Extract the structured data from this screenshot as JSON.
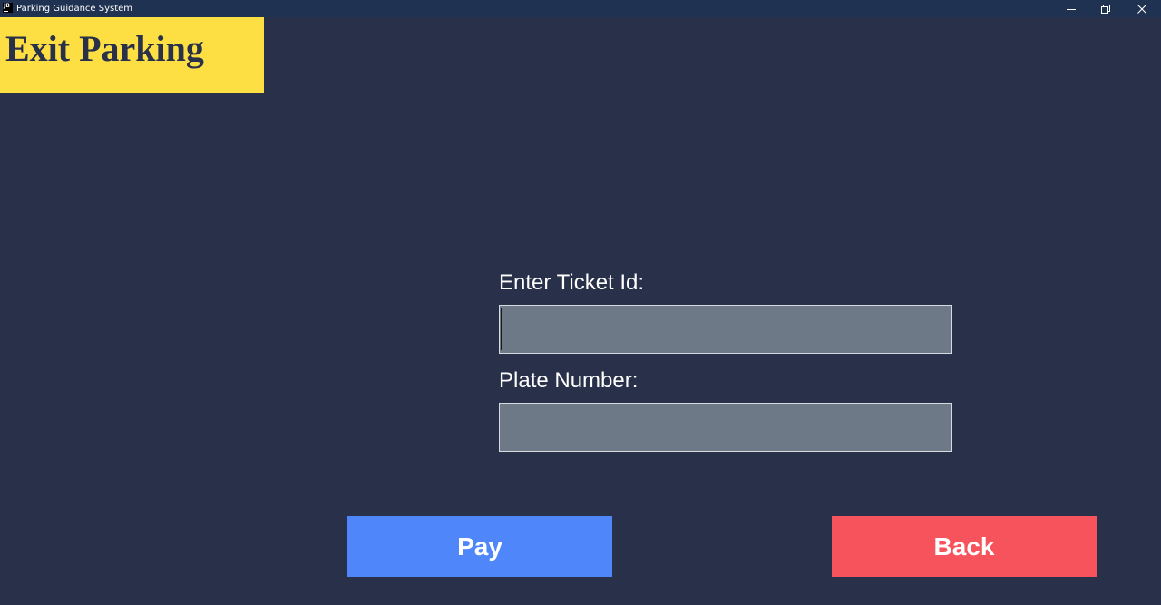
{
  "window": {
    "title": "Parking Guidance System",
    "icon_text": "JB",
    "controls": {
      "minimize_icon": "minimize-icon",
      "restore_icon": "restore-icon",
      "close_icon": "close-icon"
    },
    "titlebar_color": "#1f3251"
  },
  "header": {
    "title": "Exit Parking",
    "background_color": "#fedf43"
  },
  "form": {
    "ticket_label": "Enter Ticket Id:",
    "ticket_value": "",
    "plate_label": "Plate Number:",
    "plate_value": ""
  },
  "buttons": {
    "pay_label": "Pay",
    "pay_color": "#4f87fb",
    "back_label": "Back",
    "back_color": "#f7535c"
  },
  "colors": {
    "background": "#283149",
    "input_background": "#6e7987"
  }
}
